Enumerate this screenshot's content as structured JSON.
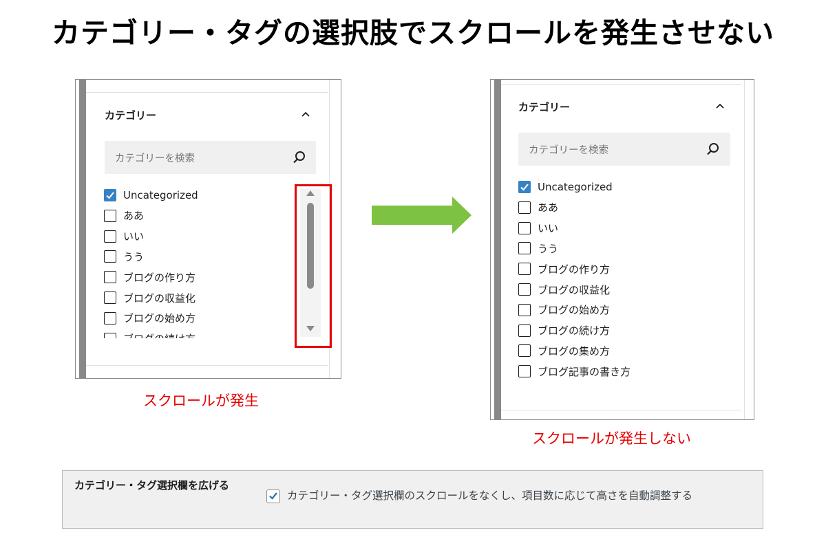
{
  "title": "カテゴリー・タグの選択肢でスクロールを発生させない",
  "before": {
    "panel_title": "カテゴリー",
    "search_placeholder": "カテゴリーを検索",
    "items": [
      {
        "label": "Uncategorized",
        "checked": true
      },
      {
        "label": "ああ",
        "checked": false
      },
      {
        "label": "いい",
        "checked": false
      },
      {
        "label": "うう",
        "checked": false
      },
      {
        "label": "ブログの作り方",
        "checked": false
      },
      {
        "label": "ブログの収益化",
        "checked": false
      },
      {
        "label": "ブログの始め方",
        "checked": false
      },
      {
        "label": "ブログの続け方",
        "checked": false
      }
    ],
    "caption": "スクロールが発生"
  },
  "after": {
    "panel_title": "カテゴリー",
    "search_placeholder": "カテゴリーを検索",
    "items": [
      {
        "label": "Uncategorized",
        "checked": true
      },
      {
        "label": "ああ",
        "checked": false
      },
      {
        "label": "いい",
        "checked": false
      },
      {
        "label": "うう",
        "checked": false
      },
      {
        "label": "ブログの作り方",
        "checked": false
      },
      {
        "label": "ブログの収益化",
        "checked": false
      },
      {
        "label": "ブログの始め方",
        "checked": false
      },
      {
        "label": "ブログの続け方",
        "checked": false
      },
      {
        "label": "ブログの集め方",
        "checked": false
      },
      {
        "label": "ブログ記事の書き方",
        "checked": false
      }
    ],
    "caption": "スクロールが発生しない"
  },
  "setting": {
    "label": "カテゴリー・タグ選択欄を広げる",
    "option_text": "カテゴリー・タグ選択欄のスクロールをなくし、項目数に応じて高さを自動調整する",
    "checked": true
  },
  "colors": {
    "accent_checkbox": "#3582c4",
    "highlight_red": "#e60000",
    "arrow_green": "#7dc242"
  },
  "icons": [
    "chevron-up-icon",
    "search-icon",
    "check-icon",
    "scroll-up-arrow-icon",
    "scroll-down-arrow-icon",
    "right-arrow-icon"
  ]
}
